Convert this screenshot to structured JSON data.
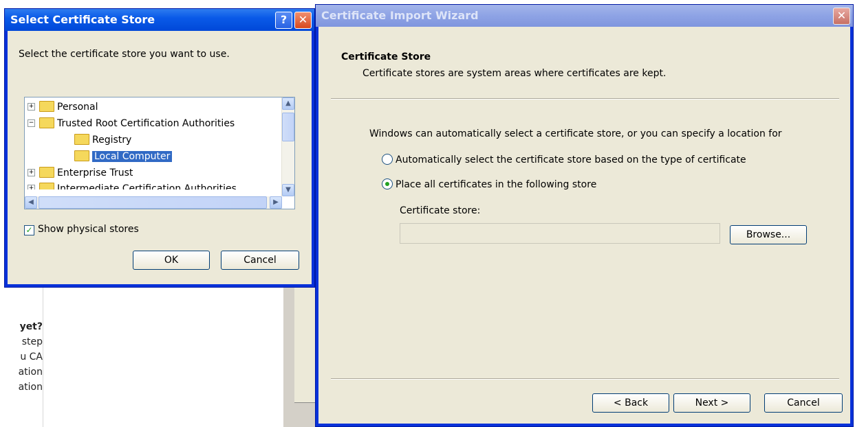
{
  "background": {
    "text_lines": [
      "yet?",
      "step",
      "u CA",
      "ation",
      "ation"
    ]
  },
  "select_store": {
    "title": "Select Certificate Store",
    "help_glyph": "?",
    "close_glyph": "✕",
    "prompt": "Select the certificate store you want to use.",
    "tree": [
      {
        "label": "Personal",
        "expander": "+"
      },
      {
        "label": "Trusted Root Certification Authorities",
        "expander": "−"
      },
      {
        "label": "Registry"
      },
      {
        "label": "Local Computer",
        "selected": true
      },
      {
        "label": "Enterprise Trust",
        "expander": "+"
      },
      {
        "label": "Intermediate Certification Authorities",
        "expander": "+"
      }
    ],
    "show_physical_label": "Show physical stores",
    "show_physical_checked": true,
    "ok_label": "OK",
    "cancel_label": "Cancel"
  },
  "wizard": {
    "title": "Certificate Import Wizard",
    "close_glyph": "✕",
    "heading": "Certificate Store",
    "subheading": "Certificate stores are system areas where certificates are kept.",
    "intro": "Windows can automatically select a certificate store, or you can specify a location for",
    "option_auto": "Automatically select the certificate store based on the type of certificate",
    "option_place": "Place all certificates in the following store",
    "selected_option": "place",
    "store_label": "Certificate store:",
    "store_value": "",
    "browse_label": "Browse...",
    "back_label": "< Back",
    "next_label": "Next >",
    "cancel_label": "Cancel"
  },
  "colors": {
    "titlebar_active": "#0a5ae8",
    "titlebar_inactive": "#8ea3e5",
    "dialog_face": "#ece9d8",
    "selection": "#316ac5"
  }
}
